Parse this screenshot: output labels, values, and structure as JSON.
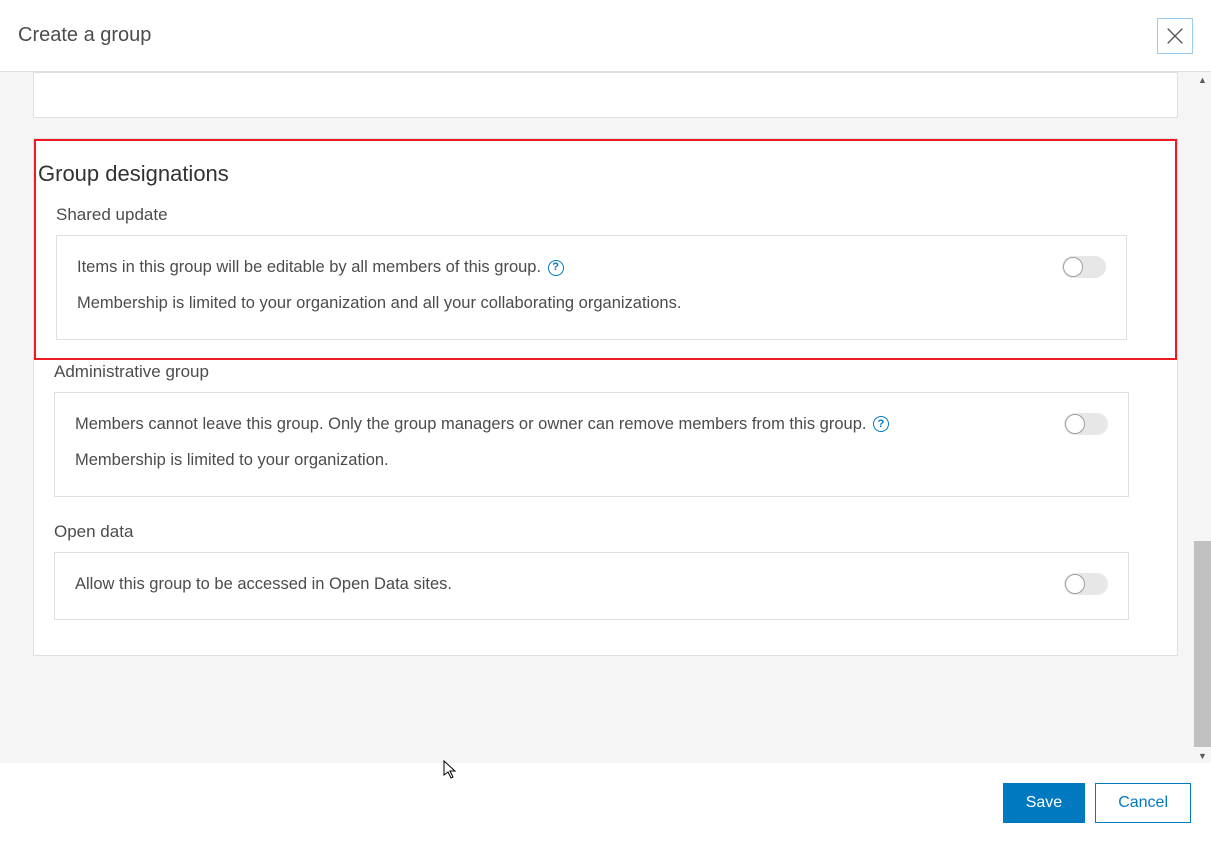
{
  "header": {
    "title": "Create a group"
  },
  "section": {
    "title": "Group designations",
    "shared_update": {
      "label": "Shared update",
      "line1": "Items in this group will be editable by all members of this group.",
      "line2": "Membership is limited to your organization and all your collaborating organizations."
    },
    "admin_group": {
      "label": "Administrative group",
      "line1": "Members cannot leave this group. Only the group managers or owner can remove members from this group.",
      "line2": "Membership is limited to your organization."
    },
    "open_data": {
      "label": "Open data",
      "line1": "Allow this group to be accessed in Open Data sites."
    }
  },
  "footer": {
    "save": "Save",
    "cancel": "Cancel"
  },
  "icons": {
    "help": "?"
  }
}
